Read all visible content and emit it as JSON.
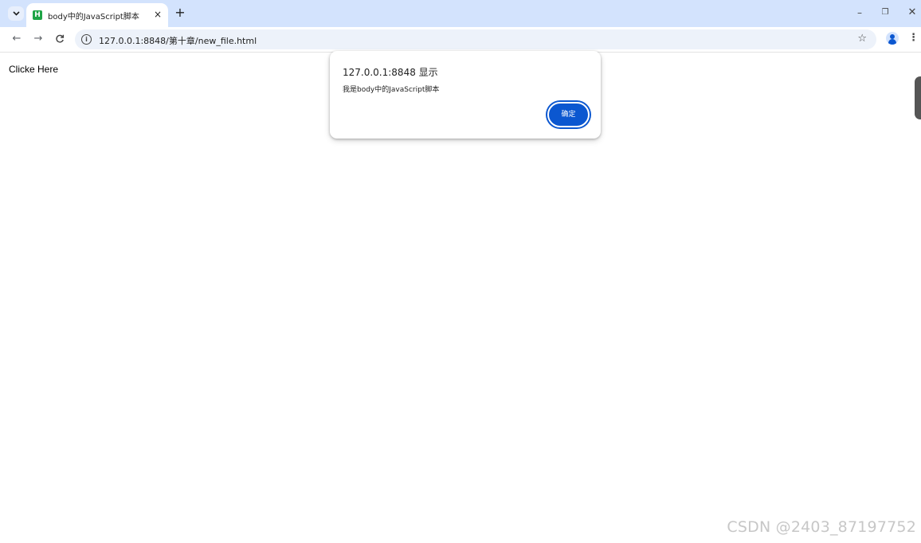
{
  "browser": {
    "tab": {
      "favicon_letter": "H",
      "title": "body中的JavaScript脚本",
      "close_glyph": "×"
    },
    "new_tab_glyph": "+",
    "window_controls": {
      "minimize": "–",
      "restore": "❐",
      "close": "✕"
    },
    "toolbar": {
      "back": "←",
      "forward": "→",
      "reload": "C",
      "site_info": "i",
      "url": "127.0.0.1:8848/第十章/new_file.html",
      "bookmark": "☆",
      "menu": "⋮"
    },
    "colors": {
      "tabstrip": "#d3e3fd",
      "omnibox": "#edf2fa",
      "accent": "#0b57d0",
      "favicon": "#1ea446"
    }
  },
  "page": {
    "link_text": "Clicke Here"
  },
  "dialog": {
    "title": "127.0.0.1:8848 显示",
    "message": "我是body中的JavaScript脚本",
    "ok_label": "确定"
  },
  "watermark": "CSDN @2403_87197752"
}
